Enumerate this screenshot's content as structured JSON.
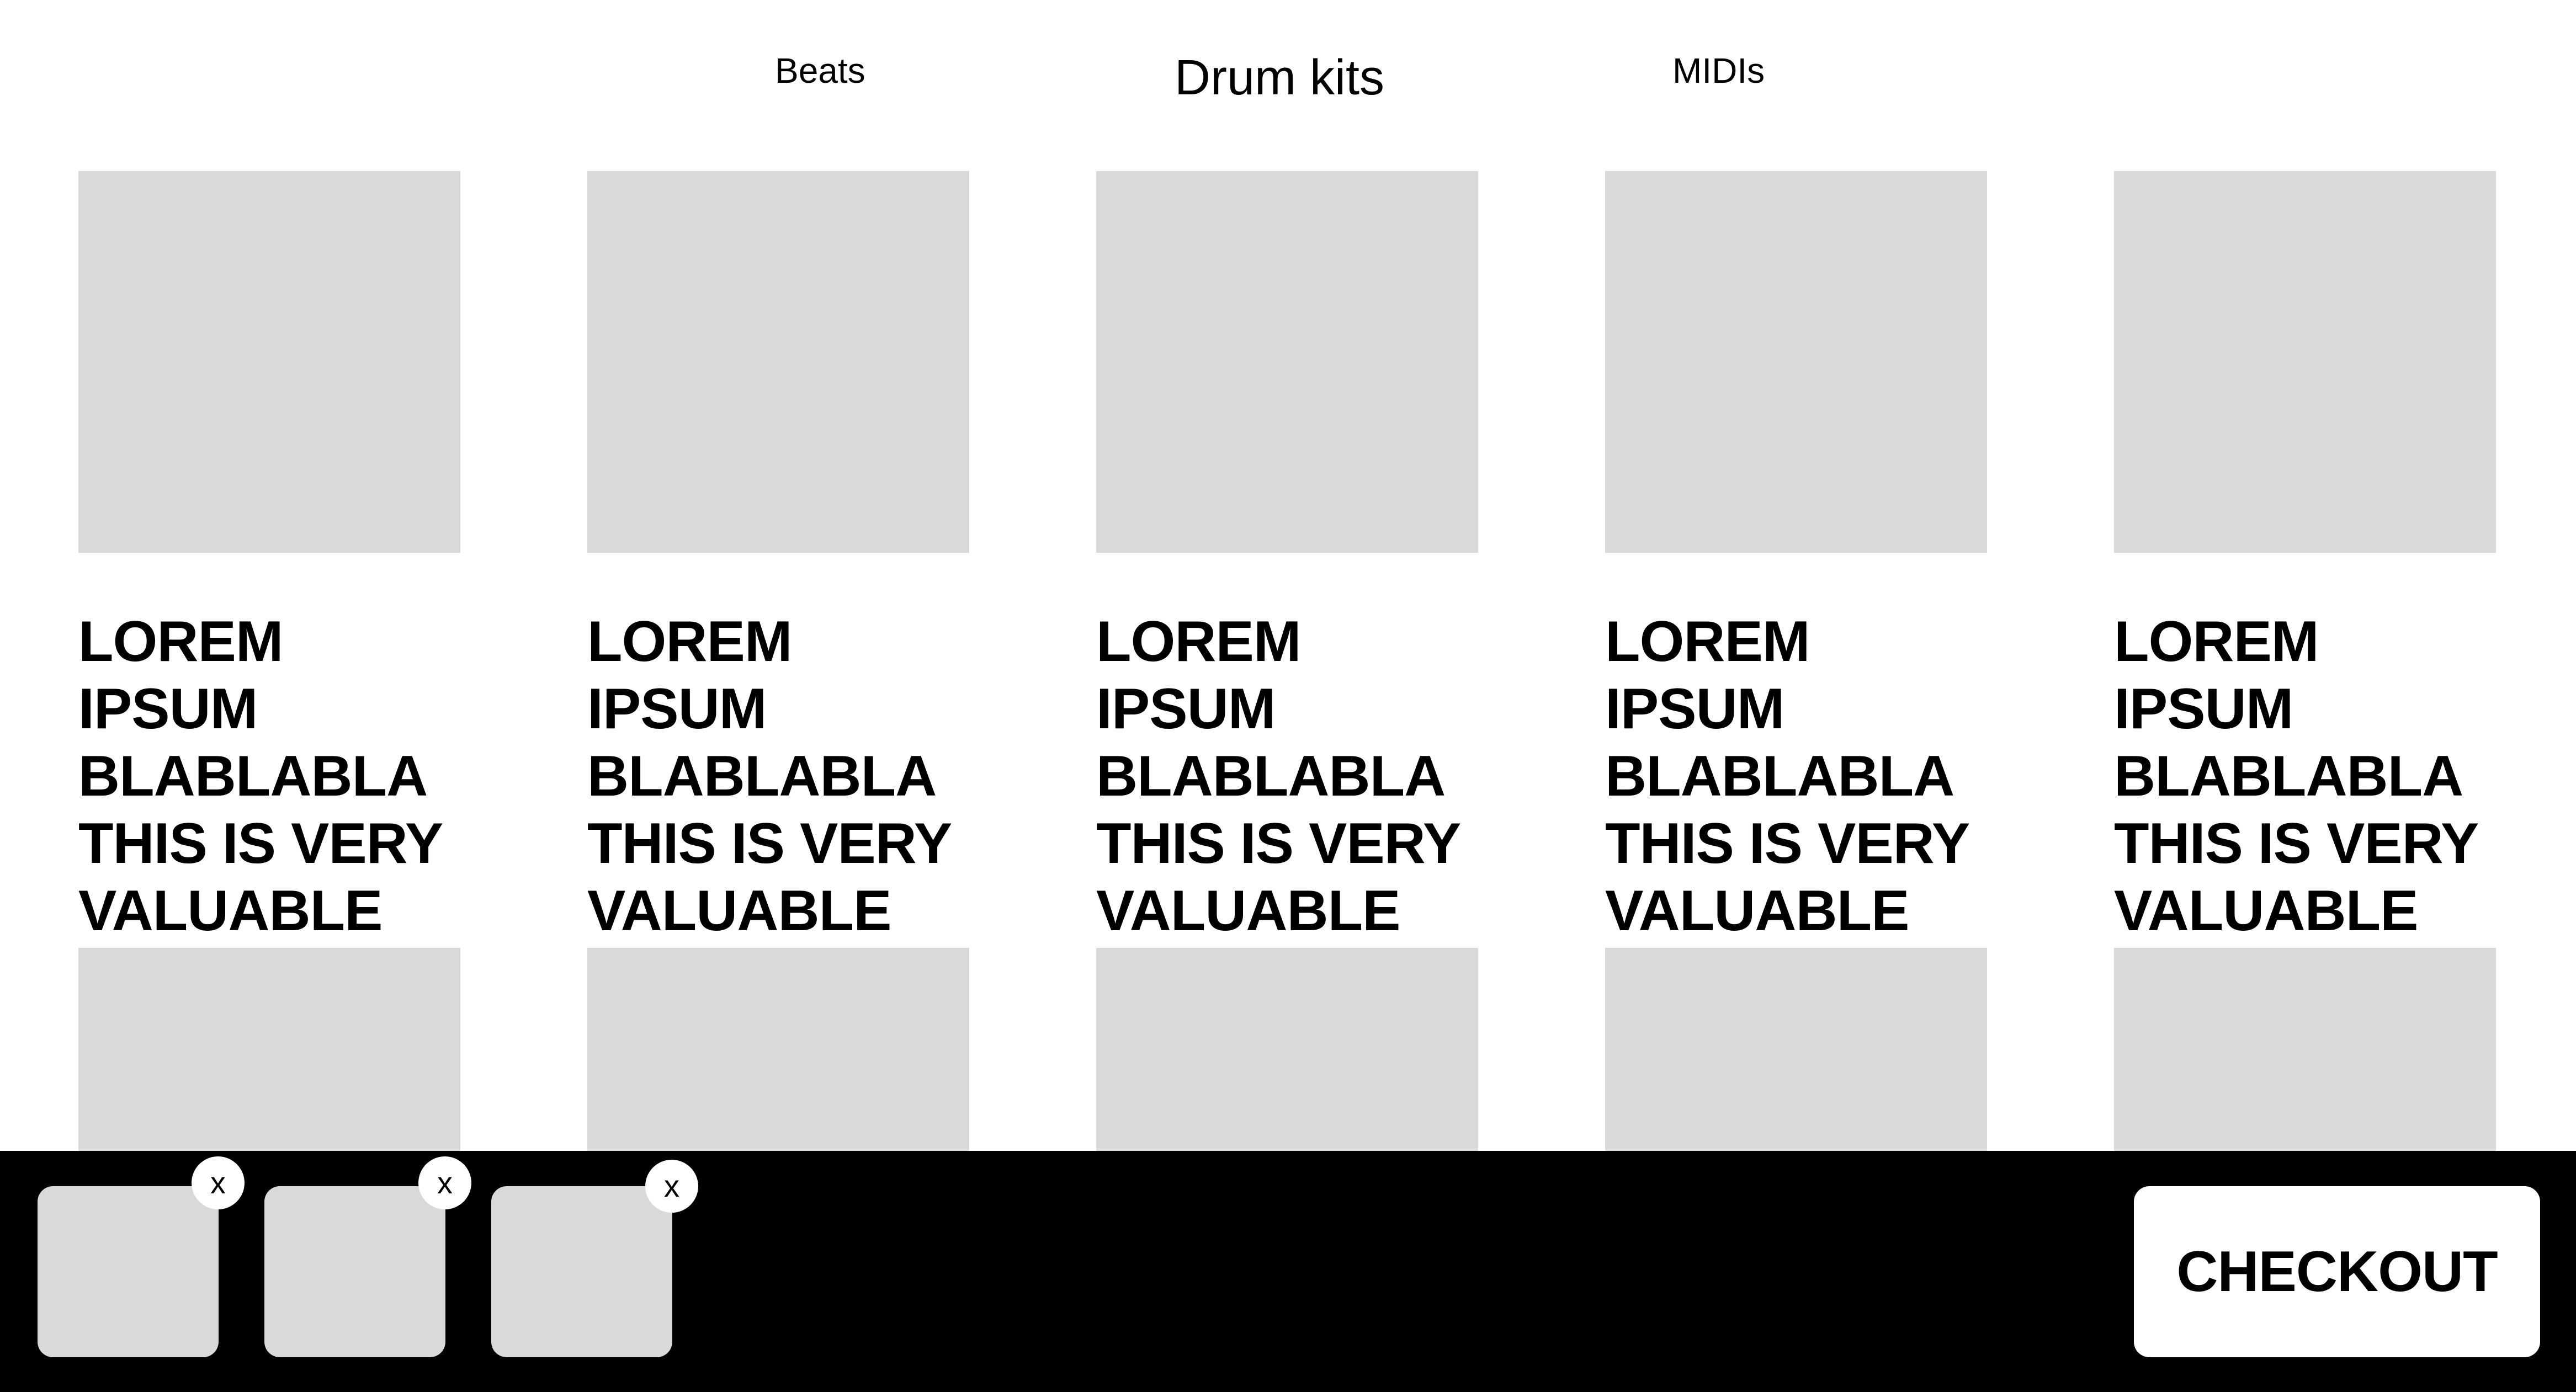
{
  "nav": {
    "items": [
      {
        "label": "Beats"
      },
      {
        "label": "Drum kits"
      },
      {
        "label": "MIDIs"
      }
    ]
  },
  "products": [
    {
      "title": "LOREM IPSUM\nBLABLABLA\nTHIS IS VERY\nVALUABLE"
    },
    {
      "title": "LOREM IPSUM\nBLABLABLA\nTHIS IS VERY\nVALUABLE"
    },
    {
      "title": "LOREM IPSUM\nBLABLABLA\nTHIS IS VERY\nVALUABLE"
    },
    {
      "title": "LOREM IPSUM\nBLABLABLA\nTHIS IS VERY\nVALUABLE"
    },
    {
      "title": "LOREM IPSUM\nBLABLABLA\nTHIS IS VERY\nVALUABLE"
    }
  ],
  "cart": {
    "items": [
      {
        "remove_label": "x"
      },
      {
        "remove_label": "x"
      },
      {
        "remove_label": "x"
      }
    ],
    "checkout_label": "CHECKOUT"
  },
  "colors": {
    "placeholder": "#d9d9d9",
    "cart_bar": "#000000",
    "background": "#ffffff"
  },
  "icons": {
    "remove": "close-icon"
  }
}
